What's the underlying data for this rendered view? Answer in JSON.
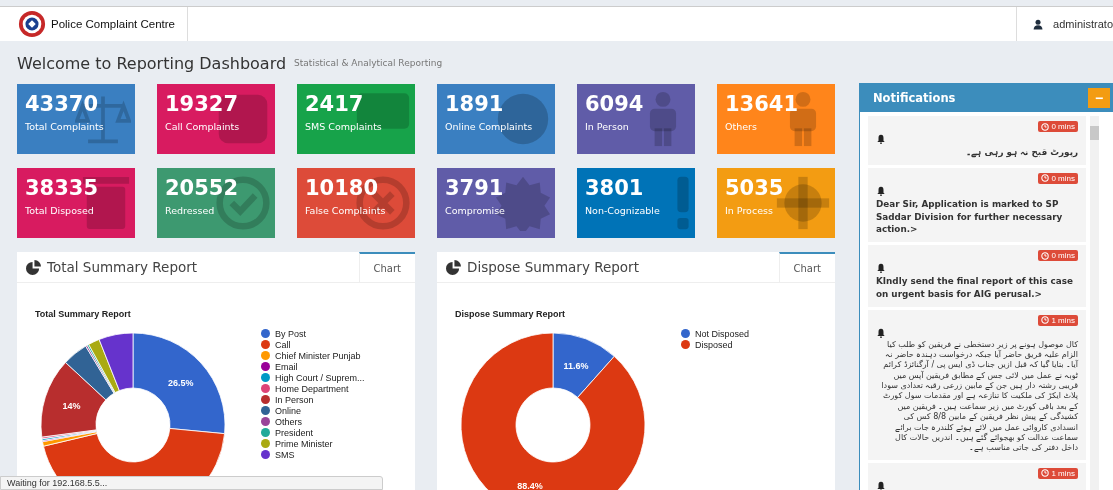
{
  "header": {
    "brand": "Police Complaint Centre",
    "user": "administrato"
  },
  "page": {
    "title": "Welcome to Reporting Dashboard",
    "subtitle": "Statistical & Analytical Reporting"
  },
  "tiles": [
    {
      "value": "43370",
      "label": "Total Complaints",
      "color": "#3a7fc1"
    },
    {
      "value": "19327",
      "label": "Call Complaints",
      "color": "#d81b60"
    },
    {
      "value": "2417",
      "label": "SMS Complaints",
      "color": "#17a34a"
    },
    {
      "value": "1891",
      "label": "Online Complaints",
      "color": "#3a7fc1"
    },
    {
      "value": "6094",
      "label": "In Person",
      "color": "#605ca8"
    },
    {
      "value": "13641",
      "label": "Others",
      "color": "#ff851b"
    },
    {
      "value": "38335",
      "label": "Total Disposed",
      "color": "#d81b60"
    },
    {
      "value": "20552",
      "label": "Redressed",
      "color": "#3d9970"
    },
    {
      "value": "10180",
      "label": "False Complaints",
      "color": "#dd4b39"
    },
    {
      "value": "3791",
      "label": "Compromise",
      "color": "#605ca8"
    },
    {
      "value": "3801",
      "label": "Non-Cognizable",
      "color": "#0073b7"
    },
    {
      "value": "5035",
      "label": "In Process",
      "color": "#f39c12"
    }
  ],
  "panels": [
    {
      "title": "Total Summary Report",
      "tab": "Chart",
      "chart_data": {
        "type": "donut",
        "title": "Total Summary Report",
        "categories": [
          "By Post",
          "Call",
          "Chief Minister Punjab",
          "Email",
          "High Court / Suprem...",
          "Home Department",
          "In Person",
          "Online",
          "Others",
          "President",
          "Prime Minister",
          "SMS"
        ],
        "series": [
          {
            "values": [
              26.5,
              44.8,
              0.8,
              0.2,
              0.3,
              0.3,
              14,
              4.5,
              0.3,
              0.3,
              2,
              6
            ]
          }
        ],
        "legend": "right",
        "colors": [
          "#3366cc",
          "#dc3912",
          "#ff9900",
          "#990099",
          "#0099c6",
          "#dd4477",
          "#b82e2e",
          "#316395",
          "#994499",
          "#22aa99",
          "#aaaa11",
          "#6633cc"
        ],
        "value_labels": [
          "26.5%",
          null,
          null,
          null,
          null,
          null,
          "14%",
          null,
          null,
          null,
          null,
          null
        ]
      }
    },
    {
      "title": "Dispose Summary Report",
      "tab": "Chart",
      "chart_data": {
        "type": "donut",
        "title": "Dispose Summary Report",
        "categories": [
          "Not Disposed",
          "Disposed"
        ],
        "series": [
          {
            "values": [
              11.6,
              88.4
            ]
          }
        ],
        "legend": "right",
        "colors": [
          "#3366cc",
          "#dc3912"
        ],
        "value_labels": [
          "11.6%",
          "88.4%"
        ]
      }
    }
  ],
  "notifications": {
    "title": "Notifications",
    "collapse_symbol": "−",
    "items": [
      {
        "time": "0 mins",
        "text": "رپورٹ قبح نہ ہو رہی ہے۔"
      },
      {
        "time": "0 mins",
        "text": "Dear Sir, Application is marked to SP Saddar Division for further necessary action.>"
      },
      {
        "time": "0 mins",
        "text": "KIndly send the final report of this case on urgent basis for AIG perusal.>"
      },
      {
        "time": "1 mins",
        "text": "کال موصول ہونے پر زیر دستخطی نے فریقین کو طلب کیا الزام علیہ فریق حاضر آیا جبکہ درخواست دہندہ حاضر نہ آیا۔ بتایا گیا کہ قبل ازیں جناب ڈی ایس پی / آرگنائزڈ کرائم ٹوبہ نے عمل میں لائی جس کے مطابق فریقین آپس میں قریبی رشتہ دار ہیں جن کے مابین زرعی رقبہ تعدادی سودا پلاٹ ایکڑ کی ملکیت کا تنازعہ ہے اور مقدمات سول کورٹ کے بعد باقی کورٹ میں زیر سماعت ہیں۔ فریقین میں کشیدگی کے پیش نظر فریقین کے مابین 8/8 کس کی انسدادی کاروائی عمل میں لائے ہوئے کلندرہ جات برائے سماعت عدالت کو بھجوائے گئے ہیں۔ اندریں حالات کال داخل دفتر کی جاتی مناسب ہے۔"
      },
      {
        "time": "1 mins"
      }
    ]
  },
  "status_bar": "Waiting for 192.168.5.5..."
}
